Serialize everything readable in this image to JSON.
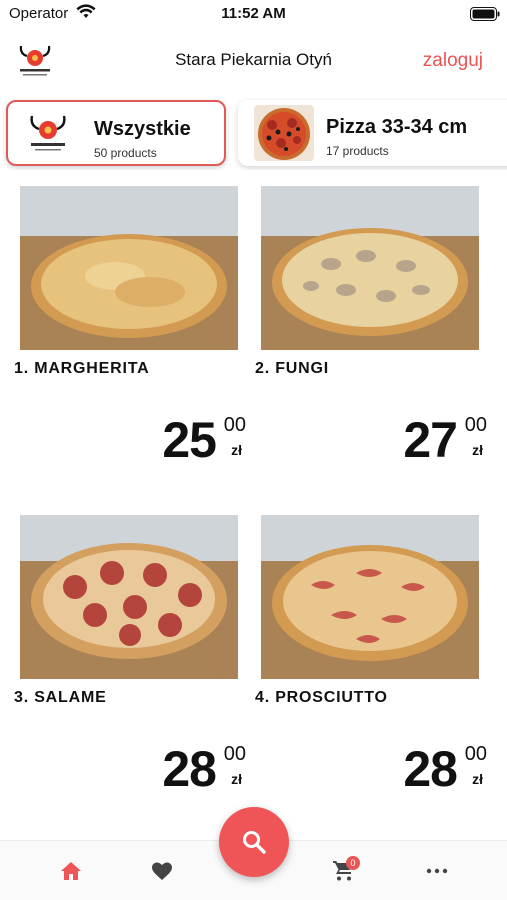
{
  "status_bar": {
    "carrier": "Operator",
    "time": "11:52 AM"
  },
  "header": {
    "title": "Stara Piekarnia Otyń",
    "login_label": "zaloguj",
    "logo_text": "Stara Piekarnia"
  },
  "categories": [
    {
      "name": "Wszystkie",
      "count": "50 products",
      "active": true,
      "thumb": "brand-logo"
    },
    {
      "name": "Pizza 33-34 cm",
      "count": "17 products",
      "active": false,
      "thumb": "pizza-photo"
    }
  ],
  "products": [
    {
      "name": "1. MARGHERITA",
      "price_int": "25",
      "price_dec": "00",
      "currency": "zł",
      "image": "margherita-photo"
    },
    {
      "name": "2. FUNGI",
      "price_int": "27",
      "price_dec": "00",
      "currency": "zł",
      "image": "fungi-photo"
    },
    {
      "name": "3. SALAME",
      "price_int": "28",
      "price_dec": "00",
      "currency": "zł",
      "image": "salame-photo"
    },
    {
      "name": "4. PROSCIUTTO",
      "price_int": "28",
      "price_dec": "00",
      "currency": "zł",
      "image": "prosciutto-photo"
    }
  ],
  "bottom_nav": {
    "items": [
      "home-icon",
      "heart-icon",
      "cart-icon",
      "more-icon"
    ],
    "cart_count": "0",
    "fab_icon": "search-icon"
  },
  "colors": {
    "accent": "#ef5556",
    "login": "#e85555",
    "active_border": "#e05a5a"
  }
}
